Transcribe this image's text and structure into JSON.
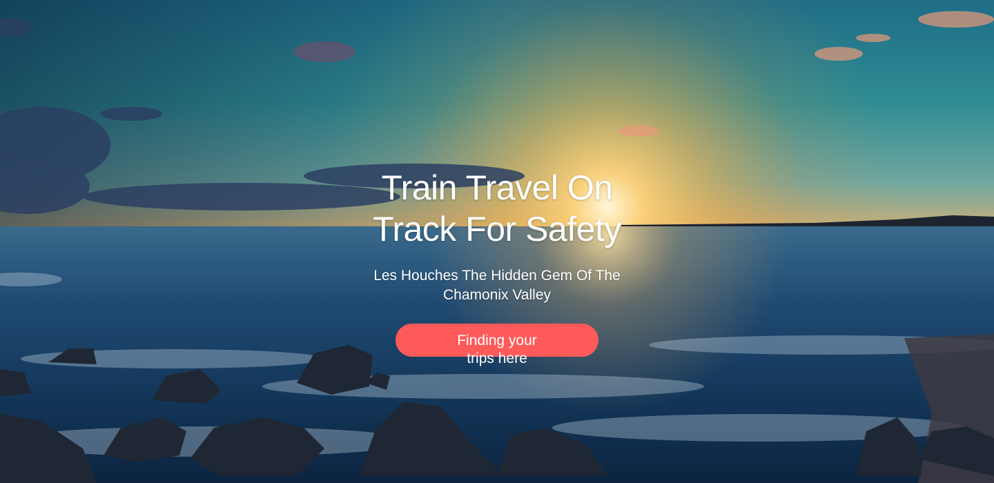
{
  "hero": {
    "title": "Train Travel On Track For Safety",
    "subtitle": "Les Houches The Hidden Gem Of The Chamonix Valley",
    "cta_label": "Finding your trips here",
    "background": "sunset-sea-photo",
    "accent_color": "#ff5a5a"
  }
}
